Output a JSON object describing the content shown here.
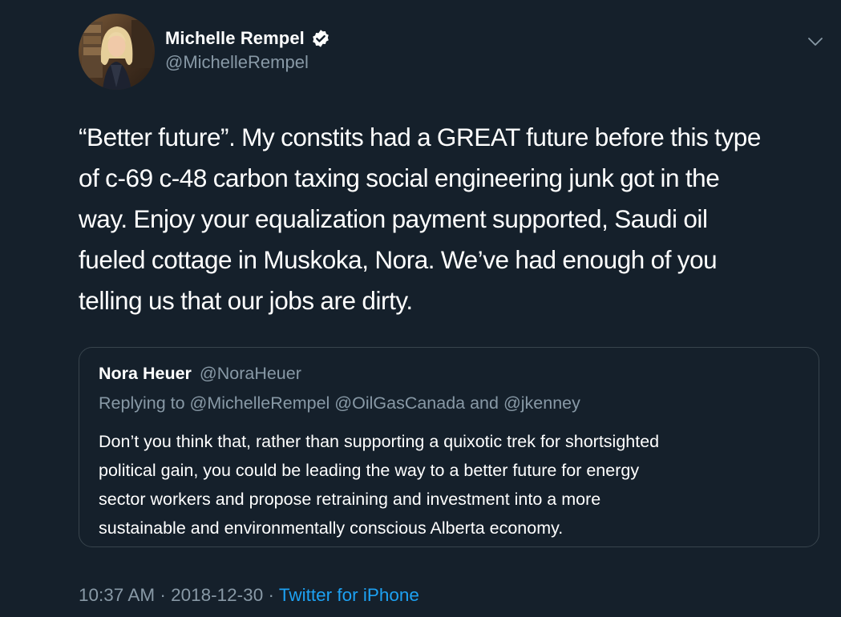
{
  "author": {
    "display_name": "Michelle Rempel",
    "handle": "@MichelleRempel",
    "verified": true,
    "avatar": "profile-photo"
  },
  "tweet": {
    "text": "“Better future”. My constits had a GREAT future before this type\nof c-69 c-48 carbon taxing social engineering junk got in the\nway. Enjoy your equalization payment supported, Saudi oil\nfueled cottage in Muskoka, Nora. We’ve had enough of you\ntelling us that our jobs are dirty."
  },
  "quoted_tweet": {
    "display_name": "Nora Heuer",
    "handle": "@NoraHeuer",
    "replying_to": "Replying to @MichelleRempel @OilGasCanada and @jkenney",
    "text": "Don’t you think that, rather than supporting a quixotic trek for shortsighted\npolitical gain, you could be leading the way to a better future for energy\nsector workers and propose retraining and investment into a more\nsustainable and environmentally conscious Alberta economy."
  },
  "meta": {
    "time": "10:37 AM",
    "separator": "·",
    "date": "2018-12-30",
    "source": "Twitter for iPhone"
  },
  "icons": {
    "verified": "verified-badge-icon",
    "menu": "chevron-down-icon"
  },
  "colors": {
    "background": "#15202b",
    "secondary_text": "#8899a6",
    "link": "#1da1f2",
    "border": "#38444d"
  }
}
